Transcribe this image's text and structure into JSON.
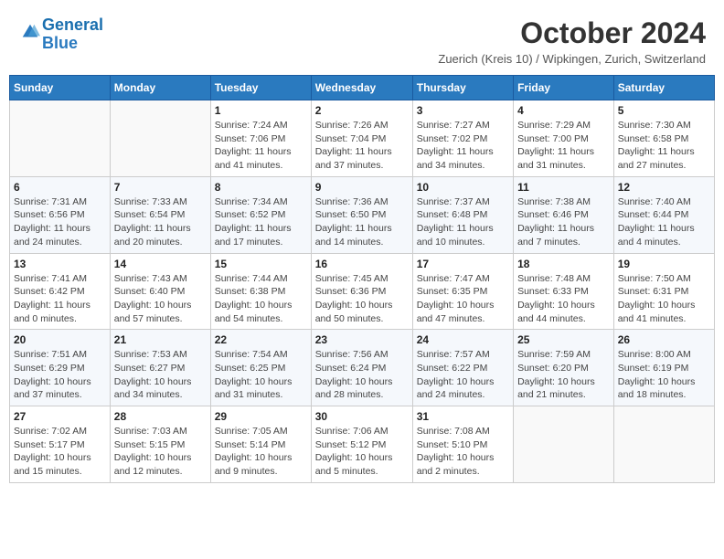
{
  "header": {
    "logo_general": "General",
    "logo_blue": "Blue",
    "title": "October 2024",
    "subtitle": "Zuerich (Kreis 10) / Wipkingen, Zurich, Switzerland"
  },
  "days_of_week": [
    "Sunday",
    "Monday",
    "Tuesday",
    "Wednesday",
    "Thursday",
    "Friday",
    "Saturday"
  ],
  "weeks": [
    [
      {
        "num": "",
        "sunrise": "",
        "sunset": "",
        "daylight": ""
      },
      {
        "num": "",
        "sunrise": "",
        "sunset": "",
        "daylight": ""
      },
      {
        "num": "1",
        "sunrise": "Sunrise: 7:24 AM",
        "sunset": "Sunset: 7:06 PM",
        "daylight": "Daylight: 11 hours and 41 minutes."
      },
      {
        "num": "2",
        "sunrise": "Sunrise: 7:26 AM",
        "sunset": "Sunset: 7:04 PM",
        "daylight": "Daylight: 11 hours and 37 minutes."
      },
      {
        "num": "3",
        "sunrise": "Sunrise: 7:27 AM",
        "sunset": "Sunset: 7:02 PM",
        "daylight": "Daylight: 11 hours and 34 minutes."
      },
      {
        "num": "4",
        "sunrise": "Sunrise: 7:29 AM",
        "sunset": "Sunset: 7:00 PM",
        "daylight": "Daylight: 11 hours and 31 minutes."
      },
      {
        "num": "5",
        "sunrise": "Sunrise: 7:30 AM",
        "sunset": "Sunset: 6:58 PM",
        "daylight": "Daylight: 11 hours and 27 minutes."
      }
    ],
    [
      {
        "num": "6",
        "sunrise": "Sunrise: 7:31 AM",
        "sunset": "Sunset: 6:56 PM",
        "daylight": "Daylight: 11 hours and 24 minutes."
      },
      {
        "num": "7",
        "sunrise": "Sunrise: 7:33 AM",
        "sunset": "Sunset: 6:54 PM",
        "daylight": "Daylight: 11 hours and 20 minutes."
      },
      {
        "num": "8",
        "sunrise": "Sunrise: 7:34 AM",
        "sunset": "Sunset: 6:52 PM",
        "daylight": "Daylight: 11 hours and 17 minutes."
      },
      {
        "num": "9",
        "sunrise": "Sunrise: 7:36 AM",
        "sunset": "Sunset: 6:50 PM",
        "daylight": "Daylight: 11 hours and 14 minutes."
      },
      {
        "num": "10",
        "sunrise": "Sunrise: 7:37 AM",
        "sunset": "Sunset: 6:48 PM",
        "daylight": "Daylight: 11 hours and 10 minutes."
      },
      {
        "num": "11",
        "sunrise": "Sunrise: 7:38 AM",
        "sunset": "Sunset: 6:46 PM",
        "daylight": "Daylight: 11 hours and 7 minutes."
      },
      {
        "num": "12",
        "sunrise": "Sunrise: 7:40 AM",
        "sunset": "Sunset: 6:44 PM",
        "daylight": "Daylight: 11 hours and 4 minutes."
      }
    ],
    [
      {
        "num": "13",
        "sunrise": "Sunrise: 7:41 AM",
        "sunset": "Sunset: 6:42 PM",
        "daylight": "Daylight: 11 hours and 0 minutes."
      },
      {
        "num": "14",
        "sunrise": "Sunrise: 7:43 AM",
        "sunset": "Sunset: 6:40 PM",
        "daylight": "Daylight: 10 hours and 57 minutes."
      },
      {
        "num": "15",
        "sunrise": "Sunrise: 7:44 AM",
        "sunset": "Sunset: 6:38 PM",
        "daylight": "Daylight: 10 hours and 54 minutes."
      },
      {
        "num": "16",
        "sunrise": "Sunrise: 7:45 AM",
        "sunset": "Sunset: 6:36 PM",
        "daylight": "Daylight: 10 hours and 50 minutes."
      },
      {
        "num": "17",
        "sunrise": "Sunrise: 7:47 AM",
        "sunset": "Sunset: 6:35 PM",
        "daylight": "Daylight: 10 hours and 47 minutes."
      },
      {
        "num": "18",
        "sunrise": "Sunrise: 7:48 AM",
        "sunset": "Sunset: 6:33 PM",
        "daylight": "Daylight: 10 hours and 44 minutes."
      },
      {
        "num": "19",
        "sunrise": "Sunrise: 7:50 AM",
        "sunset": "Sunset: 6:31 PM",
        "daylight": "Daylight: 10 hours and 41 minutes."
      }
    ],
    [
      {
        "num": "20",
        "sunrise": "Sunrise: 7:51 AM",
        "sunset": "Sunset: 6:29 PM",
        "daylight": "Daylight: 10 hours and 37 minutes."
      },
      {
        "num": "21",
        "sunrise": "Sunrise: 7:53 AM",
        "sunset": "Sunset: 6:27 PM",
        "daylight": "Daylight: 10 hours and 34 minutes."
      },
      {
        "num": "22",
        "sunrise": "Sunrise: 7:54 AM",
        "sunset": "Sunset: 6:25 PM",
        "daylight": "Daylight: 10 hours and 31 minutes."
      },
      {
        "num": "23",
        "sunrise": "Sunrise: 7:56 AM",
        "sunset": "Sunset: 6:24 PM",
        "daylight": "Daylight: 10 hours and 28 minutes."
      },
      {
        "num": "24",
        "sunrise": "Sunrise: 7:57 AM",
        "sunset": "Sunset: 6:22 PM",
        "daylight": "Daylight: 10 hours and 24 minutes."
      },
      {
        "num": "25",
        "sunrise": "Sunrise: 7:59 AM",
        "sunset": "Sunset: 6:20 PM",
        "daylight": "Daylight: 10 hours and 21 minutes."
      },
      {
        "num": "26",
        "sunrise": "Sunrise: 8:00 AM",
        "sunset": "Sunset: 6:19 PM",
        "daylight": "Daylight: 10 hours and 18 minutes."
      }
    ],
    [
      {
        "num": "27",
        "sunrise": "Sunrise: 7:02 AM",
        "sunset": "Sunset: 5:17 PM",
        "daylight": "Daylight: 10 hours and 15 minutes."
      },
      {
        "num": "28",
        "sunrise": "Sunrise: 7:03 AM",
        "sunset": "Sunset: 5:15 PM",
        "daylight": "Daylight: 10 hours and 12 minutes."
      },
      {
        "num": "29",
        "sunrise": "Sunrise: 7:05 AM",
        "sunset": "Sunset: 5:14 PM",
        "daylight": "Daylight: 10 hours and 9 minutes."
      },
      {
        "num": "30",
        "sunrise": "Sunrise: 7:06 AM",
        "sunset": "Sunset: 5:12 PM",
        "daylight": "Daylight: 10 hours and 5 minutes."
      },
      {
        "num": "31",
        "sunrise": "Sunrise: 7:08 AM",
        "sunset": "Sunset: 5:10 PM",
        "daylight": "Daylight: 10 hours and 2 minutes."
      },
      {
        "num": "",
        "sunrise": "",
        "sunset": "",
        "daylight": ""
      },
      {
        "num": "",
        "sunrise": "",
        "sunset": "",
        "daylight": ""
      }
    ]
  ]
}
